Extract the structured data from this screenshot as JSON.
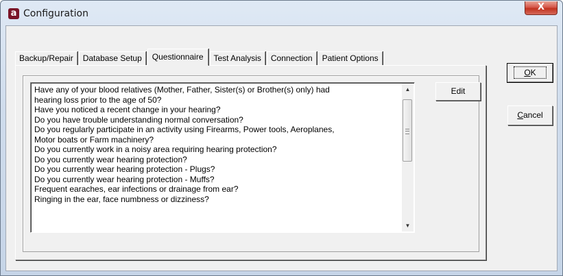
{
  "window": {
    "title": "Configuration",
    "app_icon_letter": "a",
    "close_label": "X"
  },
  "tabs": [
    {
      "label": "Backup/Repair"
    },
    {
      "label": "Database Setup"
    },
    {
      "label": "Questionnaire",
      "active": true
    },
    {
      "label": "Test Analysis"
    },
    {
      "label": "Connection"
    },
    {
      "label": "Patient Options"
    }
  ],
  "questionnaire": {
    "lines": [
      "Have any of your blood relatives (Mother, Father, Sister(s) or Brother(s) only) had",
      "hearing loss prior to the age of 50?",
      "Have you noticed a recent change in your hearing?",
      "Do you have trouble understanding normal conversation?",
      "Do you regularly participate in an activity using Firearms, Power tools, Aeroplanes,",
      "Motor boats or Farm machinery?",
      "Do you currently work in a noisy area requiring hearing protection?",
      "Do you currently wear hearing protection?",
      "Do you currently wear hearing protection - Plugs?",
      "Do you currently wear hearing protection - Muffs?",
      "Frequent earaches, ear infections or drainage from ear?",
      "Ringing in the ear, face numbness or dizziness?"
    ],
    "edit_label": "Edit"
  },
  "buttons": {
    "ok_mnemonic": "O",
    "ok_rest": "K",
    "cancel_mnemonic": "C",
    "cancel_rest": "ancel"
  },
  "scrollbar": {
    "up_arrow": "▲",
    "down_arrow": "▼"
  }
}
